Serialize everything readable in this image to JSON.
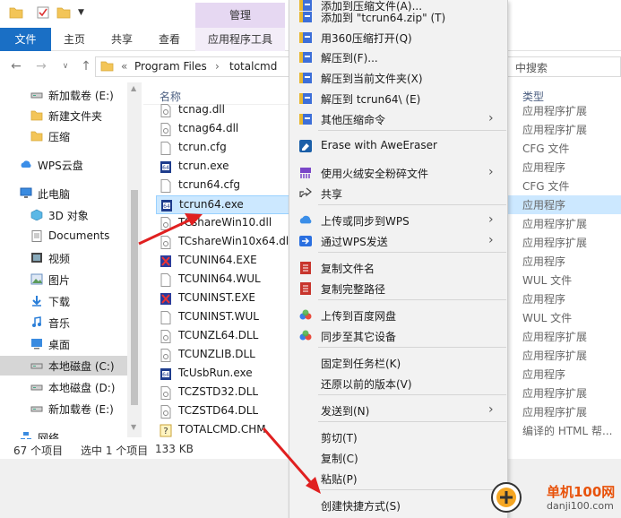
{
  "colors": {
    "file_tab": "#1a6fc5",
    "manage_tab": "#e6d8f2",
    "selection": "#cce8ff",
    "annotation_arrow": "#e02020",
    "watermark_orange": "#e8520a"
  },
  "title_strip": {
    "manage_label": "管理"
  },
  "ribbon": {
    "tabs": [
      "文件",
      "主页",
      "共享",
      "查看",
      "应用程序工具"
    ]
  },
  "address": {
    "overflow": "«",
    "crumbs": [
      "Program Files",
      "totalcmd"
    ],
    "separator": "›",
    "search_placeholder": "中搜索"
  },
  "nav": {
    "items": [
      {
        "label": "新加载卷 (E:)",
        "icon": "drive-icon"
      },
      {
        "label": "新建文件夹",
        "icon": "folder-icon"
      },
      {
        "label": "压缩",
        "icon": "folder-icon"
      },
      {
        "label": "WPS云盘",
        "icon": "cloud-icon"
      },
      {
        "label": "此电脑",
        "icon": "computer-icon"
      },
      {
        "label": "3D 对象",
        "icon": "cube-icon"
      },
      {
        "label": "Documents",
        "icon": "document-icon"
      },
      {
        "label": "视频",
        "icon": "video-icon"
      },
      {
        "label": "图片",
        "icon": "picture-icon"
      },
      {
        "label": "下载",
        "icon": "download-icon"
      },
      {
        "label": "音乐",
        "icon": "music-icon"
      },
      {
        "label": "桌面",
        "icon": "desktop-icon"
      },
      {
        "label": "本地磁盘 (C:)",
        "icon": "drive-icon"
      },
      {
        "label": "本地磁盘 (D:)",
        "icon": "drive-icon"
      },
      {
        "label": "新加载卷 (E:)",
        "icon": "drive-icon"
      },
      {
        "label": "网络",
        "icon": "network-icon"
      }
    ]
  },
  "files": {
    "column_name": "名称",
    "rows": [
      {
        "name": "tcnag.dll",
        "type": "应用程序扩展",
        "icon": "dll-icon"
      },
      {
        "name": "tcnag64.dll",
        "type": "应用程序扩展",
        "icon": "dll-icon"
      },
      {
        "name": "tcrun.cfg",
        "type": "CFG 文件",
        "icon": "file-icon"
      },
      {
        "name": "tcrun.exe",
        "type": "应用程序",
        "icon": "exe-icon"
      },
      {
        "name": "tcrun64.cfg",
        "type": "CFG 文件",
        "icon": "file-icon"
      },
      {
        "name": "tcrun64.exe",
        "type": "应用程序",
        "icon": "exe-icon"
      },
      {
        "name": "TCshareWin10.dll",
        "type": "应用程序扩展",
        "icon": "dll-icon"
      },
      {
        "name": "TCshareWin10x64.dll",
        "type": "应用程序扩展",
        "icon": "dll-icon"
      },
      {
        "name": "TCUNIN64.EXE",
        "type": "应用程序",
        "icon": "uninstall-icon"
      },
      {
        "name": "TCUNIN64.WUL",
        "type": "WUL 文件",
        "icon": "file-icon"
      },
      {
        "name": "TCUNINST.EXE",
        "type": "应用程序",
        "icon": "uninstall-icon"
      },
      {
        "name": "TCUNINST.WUL",
        "type": "WUL 文件",
        "icon": "file-icon"
      },
      {
        "name": "TCUNZL64.DLL",
        "type": "应用程序扩展",
        "icon": "dll-icon"
      },
      {
        "name": "TCUNZLIB.DLL",
        "type": "应用程序扩展",
        "icon": "dll-icon"
      },
      {
        "name": "TcUsbRun.exe",
        "type": "应用程序",
        "icon": "exe-icon"
      },
      {
        "name": "TCZSTD32.DLL",
        "type": "应用程序扩展",
        "icon": "dll-icon"
      },
      {
        "name": "TCZSTD64.DLL",
        "type": "应用程序扩展",
        "icon": "dll-icon"
      },
      {
        "name": "TOTALCMD.CHM",
        "type": "编译的 HTML 帮...",
        "icon": "help-icon"
      }
    ],
    "selected_index": 5
  },
  "type_column": {
    "header": "类型"
  },
  "status": {
    "count": "67 个项目",
    "selected": "选中 1 个项目",
    "size": "133 KB"
  },
  "context_menu": {
    "items": [
      {
        "label": "添加到压缩文件(A)...",
        "icon": "archive-icon"
      },
      {
        "label": "添加到 \"tcrun64.zip\" (T)",
        "icon": "archive-icon"
      },
      {
        "label": "用360压缩打开(Q)",
        "icon": "archive-icon"
      },
      {
        "label": "解压到(F)...",
        "icon": "archive-icon"
      },
      {
        "label": "解压到当前文件夹(X)",
        "icon": "archive-icon"
      },
      {
        "label": "解压到 tcrun64\\ (E)",
        "icon": "archive-icon"
      },
      {
        "label": "其他压缩命令",
        "icon": "archive-icon",
        "submenu": true
      },
      {
        "label": "Erase with AweEraser",
        "icon": "eraser-icon"
      },
      {
        "label": "使用火绒安全粉碎文件",
        "icon": "shredder-icon",
        "submenu": true
      },
      {
        "label": "共享",
        "icon": "share-icon"
      },
      {
        "label": "上传或同步到WPS",
        "icon": "cloud-icon",
        "submenu": true
      },
      {
        "label": "通过WPS发送",
        "icon": "wps-send-icon",
        "submenu": true
      },
      {
        "label": "复制文件名",
        "icon": "copy-name-icon"
      },
      {
        "label": "复制完整路径",
        "icon": "copy-path-icon"
      },
      {
        "label": "上传到百度网盘",
        "icon": "baidu-icon"
      },
      {
        "label": "同步至其它设备",
        "icon": "baidu-icon"
      },
      {
        "label": "固定到任务栏(K)",
        "icon": ""
      },
      {
        "label": "还原以前的版本(V)",
        "icon": ""
      },
      {
        "label": "发送到(N)",
        "icon": "",
        "submenu": true
      },
      {
        "label": "剪切(T)",
        "icon": ""
      },
      {
        "label": "复制(C)",
        "icon": ""
      },
      {
        "label": "粘贴(P)",
        "icon": ""
      },
      {
        "label": "创建快捷方式(S)",
        "icon": ""
      }
    ]
  },
  "watermark": {
    "title": "单机100网",
    "url": "danji100.com"
  }
}
